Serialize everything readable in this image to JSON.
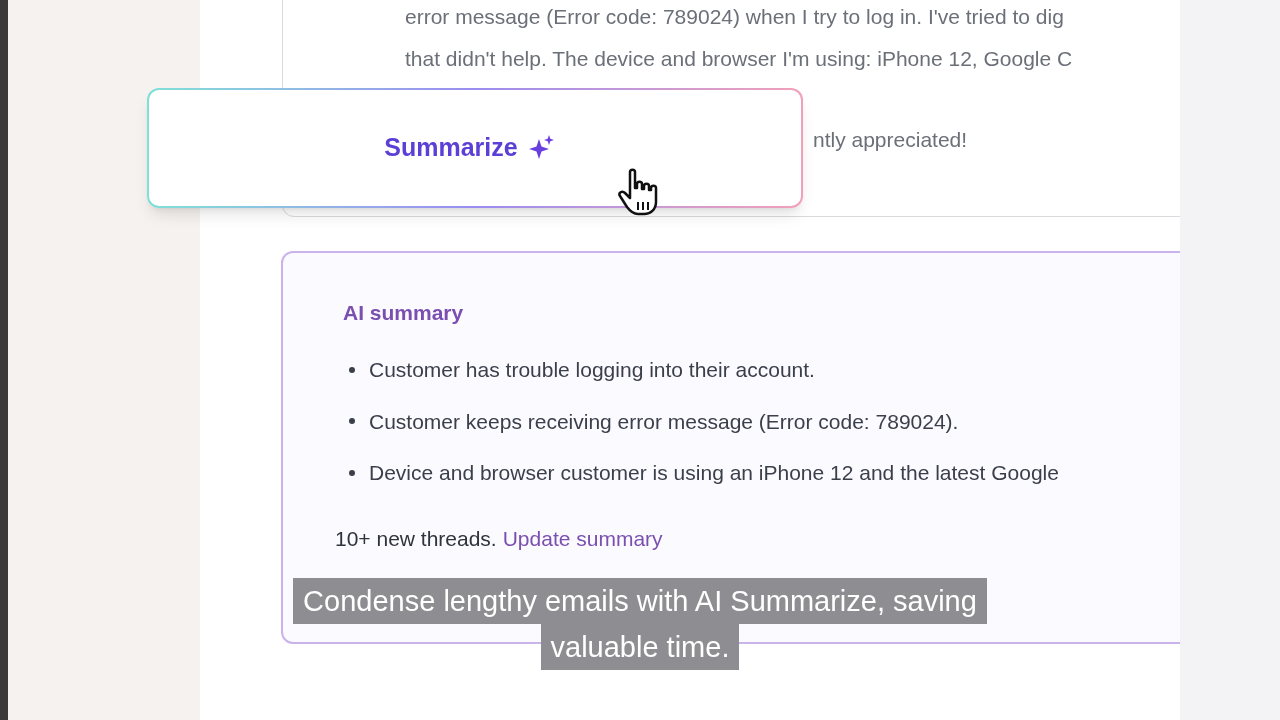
{
  "email": {
    "lines": [
      "error message (Error code: 789024) when I try to log in. I've tried to dig",
      "that didn't help. The device and browser I'm using: iPhone 12, Google C",
      "ntly appreciated!"
    ]
  },
  "summarize_button": {
    "label": "Summarize"
  },
  "summary": {
    "title": "AI summary",
    "bullets": [
      "Customer has trouble logging into their account.",
      "Customer keeps receiving error message (Error code: 789024).",
      "Device and browser customer is using an iPhone 12 and the latest Google"
    ],
    "footer": {
      "text": "10+ new threads.",
      "link": "Update summary"
    }
  },
  "caption": [
    "Condense lengthy emails with AI Summarize, saving",
    "valuable time."
  ]
}
